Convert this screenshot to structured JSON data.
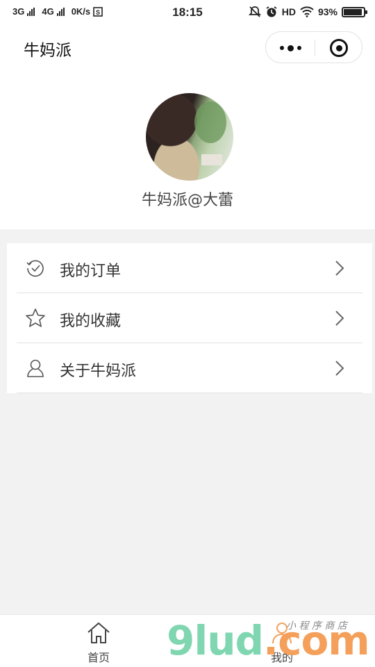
{
  "status_bar": {
    "net1": "3G",
    "net2": "4G",
    "speed": "0K/s",
    "time": "18:15",
    "hd": "HD",
    "battery_percent": "93%",
    "battery_level": 0.93
  },
  "nav": {
    "title": "牛妈派"
  },
  "profile": {
    "username": "牛妈派@大蕾"
  },
  "menu": {
    "items": [
      {
        "label": "我的订单",
        "icon": "order-check-icon"
      },
      {
        "label": "我的收藏",
        "icon": "star-icon"
      },
      {
        "label": "关于牛妈派",
        "icon": "person-icon"
      }
    ]
  },
  "tab_bar": {
    "home_label": "首页",
    "mine_label": "我的"
  },
  "watermark": {
    "text_a": "9lud",
    "text_b": ".com",
    "small": "小 程 序 商 店"
  },
  "colors": {
    "background": "#f2f2f2",
    "watermark_green": "#7fd6b0",
    "watermark_orange": "#f4a05a"
  }
}
